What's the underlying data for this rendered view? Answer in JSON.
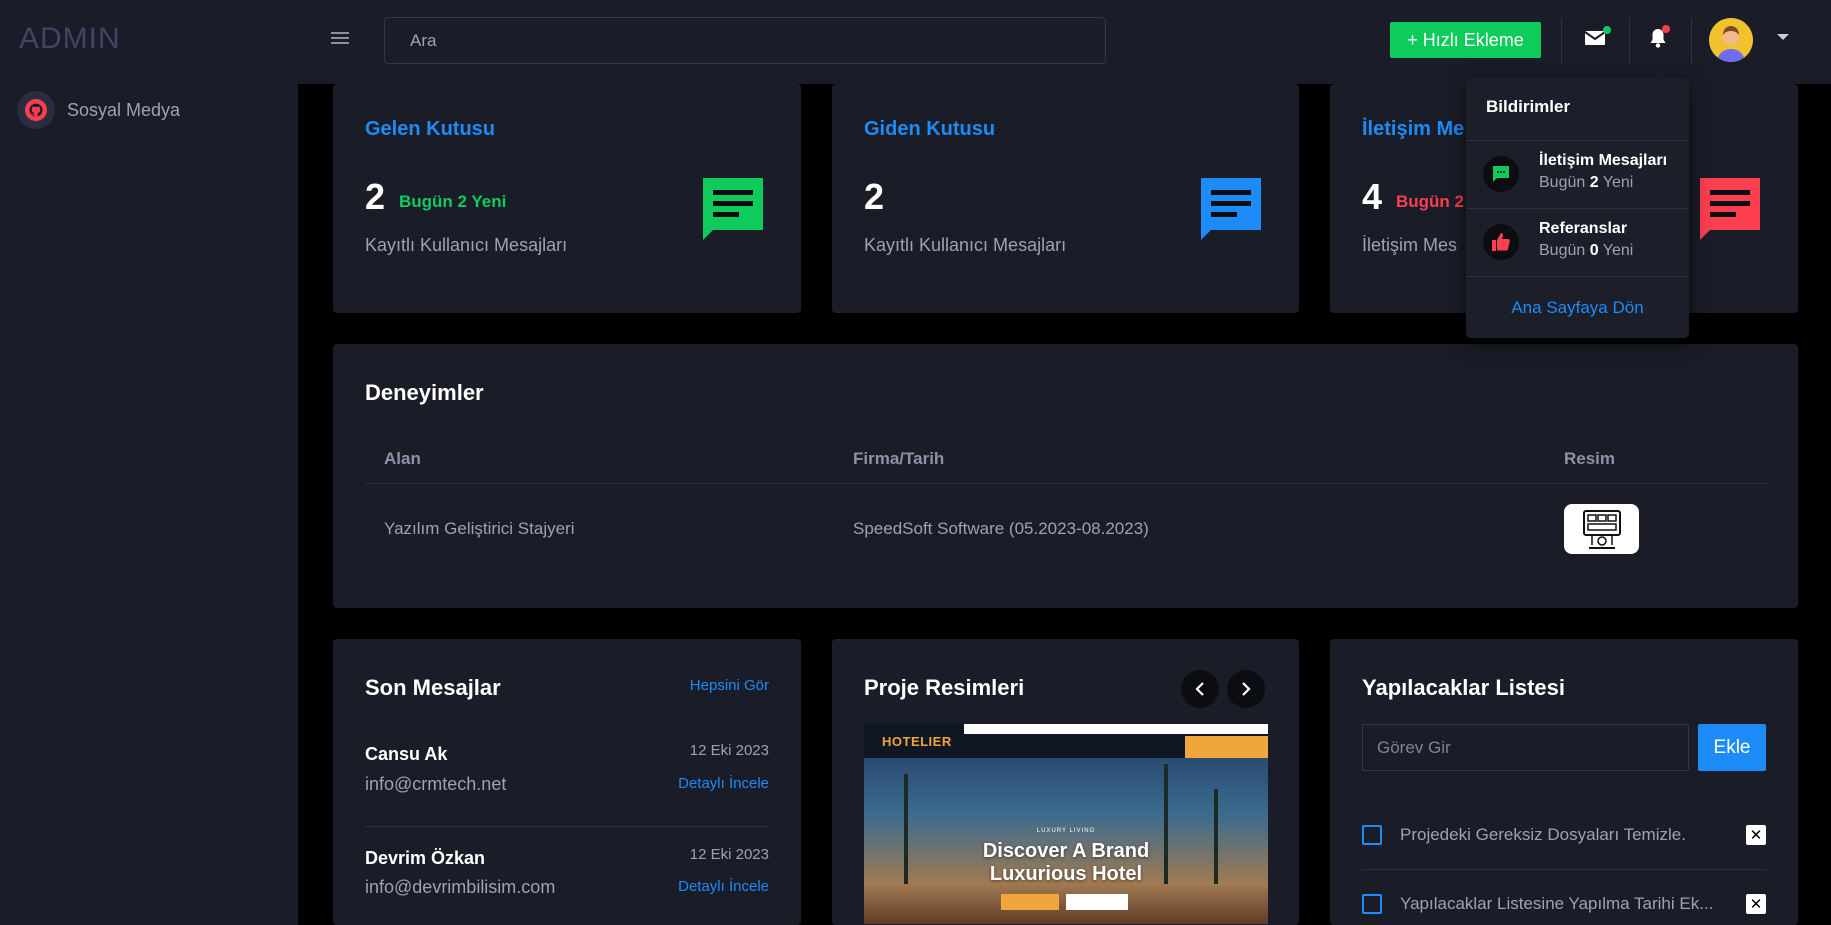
{
  "sidebar": {
    "brand": "ADMIN",
    "items": [
      {
        "label": "Sosyal Medya"
      }
    ]
  },
  "topbar": {
    "search_placeholder": "Ara",
    "quick_add_label": "+ Hızlı Ekleme"
  },
  "colors": {
    "accent": "#1d8cf8",
    "success": "#0ecb5b",
    "danger": "#fd3f4f",
    "card": "#1a1c28"
  },
  "stats": [
    {
      "title": "Gelen Kutusu",
      "count": "2",
      "new_label": "Bugün 2 Yeni",
      "subtitle": "Kayıtlı Kullanıcı Mesajları",
      "color": "#0ecb5b",
      "icon": "message-icon"
    },
    {
      "title": "Giden Kutusu",
      "count": "2",
      "new_label": "",
      "subtitle": "Kayıtlı Kullanıcı Mesajları",
      "color": "#1d8cf8",
      "icon": "message-icon"
    },
    {
      "title": "İletişim Me",
      "count": "4",
      "new_label": "Bugün 2",
      "subtitle": "İletişim Mes",
      "color": "#fd3f4f",
      "icon": "message-icon"
    }
  ],
  "experiences": {
    "title": "Deneyimler",
    "columns": [
      "Alan",
      "Firma/Tarih",
      "Resim"
    ],
    "rows": [
      {
        "field": "Yazılım Geliştirici Stajyeri",
        "company": "SpeedSoft Software (05.2023-08.2023)"
      }
    ]
  },
  "messages": {
    "title": "Son Mesajlar",
    "see_all": "Hepsini Gör",
    "items": [
      {
        "name": "Cansu Ak",
        "email": "info@crmtech.net",
        "date": "12 Eki 2023",
        "link": "Detaylı İncele"
      },
      {
        "name": "Devrim Özkan",
        "email": "info@devrimbilisim.com",
        "date": "12 Eki 2023",
        "link": "Detaylı İncele"
      }
    ]
  },
  "projects": {
    "title": "Proje Resimleri",
    "slide": {
      "logo": "HOTELIER",
      "kicker": "LUXURY LIVING",
      "heading_line1": "Discover A Brand",
      "heading_line2": "Luxurious Hotel"
    }
  },
  "todo": {
    "title": "Yapılacaklar Listesi",
    "input_placeholder": "Görev Gir",
    "add_label": "Ekle",
    "items": [
      {
        "text": "Projedeki Gereksiz Dosyaları Temizle."
      },
      {
        "text": "Yapılacaklar Listesine Yapılma Tarihi Ek..."
      }
    ]
  },
  "notifications": {
    "title": "Bildirimler",
    "items": [
      {
        "name": "İletişim Mesajları",
        "sub_prefix": "Bugün",
        "count": "2",
        "sub_suffix": "Yeni",
        "icon": "chat-icon",
        "color": "#0ecb5b"
      },
      {
        "name": "Referanslar",
        "sub_prefix": "Bugün",
        "count": "0",
        "sub_suffix": "Yeni",
        "icon": "thumbs-up-icon",
        "color": "#fd3f4f"
      }
    ],
    "footer": "Ana Sayfaya Dön"
  }
}
